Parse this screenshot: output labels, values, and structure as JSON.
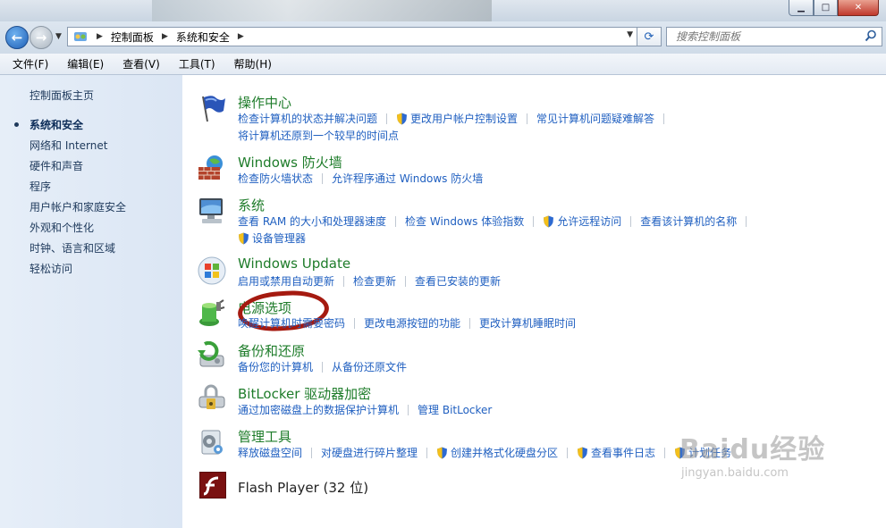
{
  "address_bar": {
    "breadcrumbs": [
      "控制面板",
      "系统和安全"
    ],
    "search_placeholder": "搜索控制面板"
  },
  "menu": [
    "文件(F)",
    "编辑(E)",
    "查看(V)",
    "工具(T)",
    "帮助(H)"
  ],
  "sidebar": {
    "home": "控制面板主页",
    "items": [
      "系统和安全",
      "网络和 Internet",
      "硬件和声音",
      "程序",
      "用户帐户和家庭安全",
      "外观和个性化",
      "时钟、语言和区域",
      "轻松访问"
    ],
    "current_index": 0
  },
  "categories": [
    {
      "title": "操作中心",
      "icon": "flag-icon",
      "rows": [
        [
          {
            "text": "检查计算机的状态并解决问题"
          },
          {
            "text": "更改用户帐户控制设置",
            "shield": true
          },
          {
            "text": "常见计算机问题疑难解答"
          }
        ],
        [
          {
            "text": "将计算机还原到一个较早的时间点"
          }
        ]
      ]
    },
    {
      "title": "Windows 防火墙",
      "icon": "firewall-icon",
      "rows": [
        [
          {
            "text": "检查防火墙状态"
          },
          {
            "text": "允许程序通过 Windows 防火墙"
          }
        ]
      ]
    },
    {
      "title": "系统",
      "icon": "computer-icon",
      "rows": [
        [
          {
            "text": "查看 RAM 的大小和处理器速度"
          },
          {
            "text": "检查 Windows 体验指数"
          },
          {
            "text": "允许远程访问",
            "shield": true
          },
          {
            "text": "查看该计算机的名称"
          }
        ],
        [
          {
            "text": "设备管理器",
            "shield": true
          }
        ]
      ]
    },
    {
      "title": "Windows Update",
      "icon": "windows-update-icon",
      "rows": [
        [
          {
            "text": "启用或禁用自动更新"
          },
          {
            "text": "检查更新"
          },
          {
            "text": "查看已安装的更新"
          }
        ]
      ]
    },
    {
      "title": "电源选项",
      "icon": "power-options-icon",
      "rows": [
        [
          {
            "text": "唤醒计算机时需要密码"
          },
          {
            "text": "更改电源按钮的功能"
          },
          {
            "text": "更改计算机睡眠时间"
          }
        ]
      ]
    },
    {
      "title": "备份和还原",
      "icon": "backup-icon",
      "rows": [
        [
          {
            "text": "备份您的计算机"
          },
          {
            "text": "从备份还原文件"
          }
        ]
      ]
    },
    {
      "title": "BitLocker 驱动器加密",
      "icon": "bitlocker-icon",
      "rows": [
        [
          {
            "text": "通过加密磁盘上的数据保护计算机"
          },
          {
            "text": "管理 BitLocker"
          }
        ]
      ]
    },
    {
      "title": "管理工具",
      "icon": "admin-tools-icon",
      "rows": [
        [
          {
            "text": "释放磁盘空间"
          },
          {
            "text": "对硬盘进行碎片整理"
          },
          {
            "text": "创建并格式化硬盘分区",
            "shield": true
          },
          {
            "text": "查看事件日志",
            "shield": true
          },
          {
            "text": "计划任务",
            "shield": true
          }
        ]
      ]
    },
    {
      "title": "Flash Player (32 位)",
      "icon": "flash-player-icon",
      "rows": []
    }
  ],
  "watermark": {
    "text": "Baidu经验",
    "url": "jingyan.baidu.com"
  },
  "colors": {
    "category_title": "#1e7c2a",
    "link": "#1f5fc0",
    "sidebar_bg": "#dbe6f4",
    "highlight_ring": "#a51a10"
  }
}
